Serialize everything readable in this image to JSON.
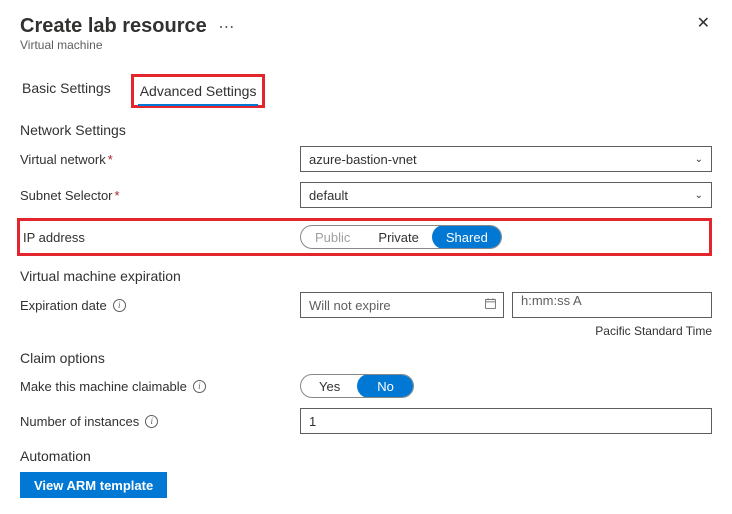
{
  "header": {
    "title": "Create lab resource",
    "subtitle": "Virtual machine"
  },
  "tabs": {
    "basic": "Basic Settings",
    "advanced": "Advanced Settings"
  },
  "sections": {
    "network": {
      "heading": "Network Settings"
    },
    "expiration": {
      "heading": "Virtual machine expiration"
    },
    "claim": {
      "heading": "Claim options"
    },
    "automation": {
      "heading": "Automation"
    }
  },
  "fields": {
    "virtualNetwork": {
      "label": "Virtual network",
      "value": "azure-bastion-vnet"
    },
    "subnet": {
      "label": "Subnet Selector",
      "value": "default"
    },
    "ipAddress": {
      "label": "IP address",
      "options": {
        "public": "Public",
        "private": "Private",
        "shared": "Shared"
      }
    },
    "expirationDate": {
      "label": "Expiration date",
      "placeholder": "Will not expire"
    },
    "expirationTime": {
      "placeholder": "h:mm:ss A"
    },
    "timezone": "Pacific Standard Time",
    "claimable": {
      "label": "Make this machine claimable",
      "options": {
        "yes": "Yes",
        "no": "No"
      }
    },
    "instances": {
      "label": "Number of instances",
      "value": "1"
    }
  },
  "buttons": {
    "viewArm": "View ARM template"
  }
}
